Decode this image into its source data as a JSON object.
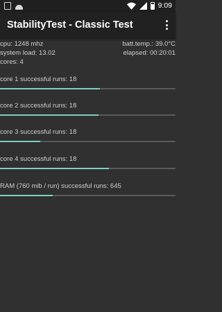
{
  "status_bar": {
    "time": "9:09",
    "icons": [
      "notification-icon",
      "android-icon",
      "wifi-icon",
      "cell-signal-icon",
      "battery-icon"
    ]
  },
  "app_bar": {
    "title": "StabilityTest - Classic Test",
    "menu_icon": "overflow-menu-icon"
  },
  "info": {
    "cpu": "cpu: 1248 mhz",
    "batt_temp": "batt.temp.: 39.0°C",
    "system_load": "system load: 13.02",
    "elapsed": "elapsed: 00:20:01",
    "cores": "cores: 4"
  },
  "stats": [
    {
      "label": "core 1 successful runs: 18",
      "progress": 0.57
    },
    {
      "label": "core 2 successful runs: 18",
      "progress": 0.56
    },
    {
      "label": "core 3 successful runs: 18",
      "progress": 0.23
    },
    {
      "label": "core 4 successful runs: 18",
      "progress": 0.62
    },
    {
      "label": "RAM (760 mib / run) successful runs: 645",
      "progress": 0.3
    }
  ],
  "colors": {
    "background": "#303030",
    "app_bar": "#212121",
    "status_bar": "#1f1f1f",
    "progress_fill": "#7fcfc3",
    "progress_track": "#5a5a5a",
    "text": "#cfcfcf"
  }
}
